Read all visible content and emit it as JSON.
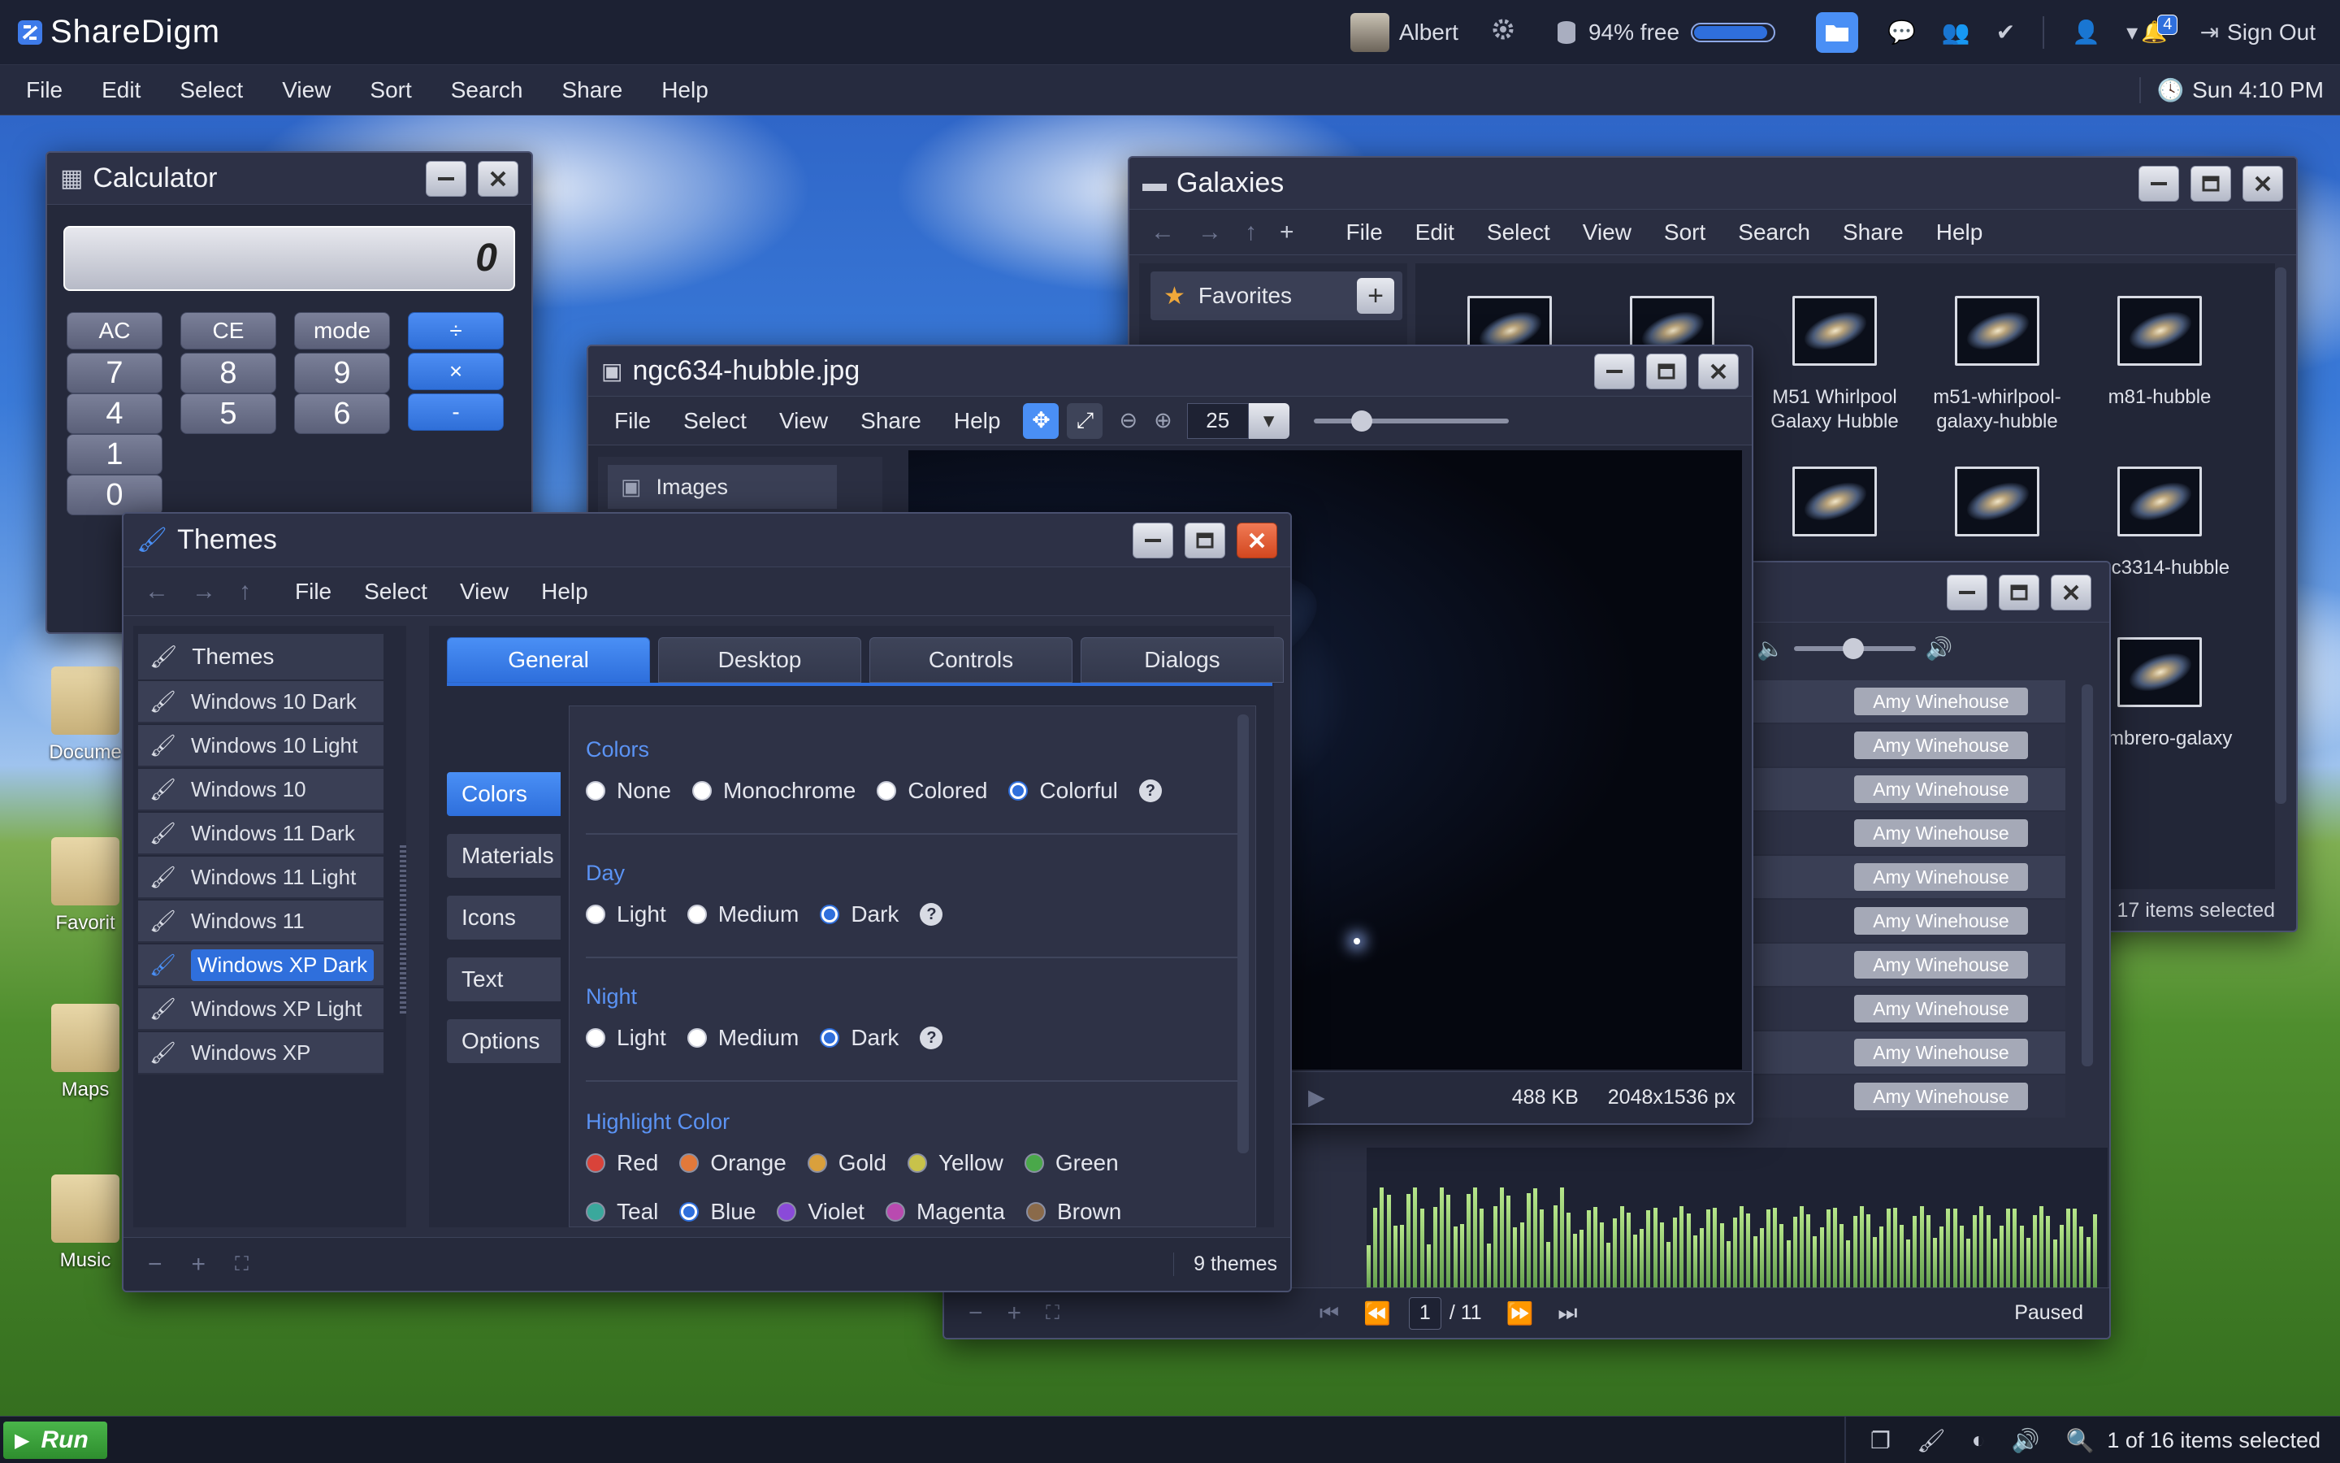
{
  "app": {
    "brand": "ShareDigm",
    "user": "Albert",
    "storage": "94% free",
    "storage_fraction": 0.94,
    "notifications_count": "4",
    "signout": "Sign Out",
    "clock": "Sun 4:10 PM"
  },
  "main_menu": [
    "File",
    "Edit",
    "Select",
    "View",
    "Sort",
    "Search",
    "Share",
    "Help"
  ],
  "desktop_icons": [
    "Docume",
    "Favorit",
    "Maps",
    "Music"
  ],
  "calculator": {
    "title": "Calculator",
    "display": "0",
    "rows": [
      [
        "AC",
        "CE",
        "mode",
        "÷"
      ],
      [
        "7",
        "8",
        "9",
        "×"
      ],
      [
        "4",
        "5",
        "6",
        "-"
      ],
      [
        "1",
        "",
        "",
        ""
      ],
      [
        "0",
        "",
        "",
        ""
      ]
    ]
  },
  "galaxies": {
    "title": "Galaxies",
    "menu": [
      "File",
      "Edit",
      "Select",
      "View",
      "Sort",
      "Search",
      "Share",
      "Help"
    ],
    "favorites_label": "Favorites",
    "items": [
      {
        "label": ""
      },
      {
        "label": ""
      },
      {
        "label": "M51 Whirlpool Galaxy Hubble"
      },
      {
        "label": "m51-whirlpool-galaxy-hubble"
      },
      {
        "label": "m81-hubble"
      },
      {
        "label": ""
      },
      {
        "label": ""
      },
      {
        "label": ""
      },
      {
        "label": "ngc3314-hubble"
      },
      {
        "label": "sombrero-galaxy"
      }
    ],
    "status": "17 items selected"
  },
  "viewer": {
    "title": "ngc634-hubble.jpg",
    "menu": [
      "File",
      "Select",
      "View",
      "Share",
      "Help"
    ],
    "zoom": "25",
    "sidebar_label": "Images",
    "file_size": "488 KB",
    "dimensions": "2048x1536 px"
  },
  "player": {
    "artists": [
      "Amy Winehouse",
      "Amy Winehouse",
      "Amy Winehouse",
      "Amy Winehouse",
      "Amy Winehouse",
      "Amy Winehouse",
      "Amy Winehouse",
      "Amy Winehouse",
      "Amy Winehouse",
      "Amy Winehouse"
    ],
    "page": "1",
    "page_total": "/ 11",
    "status": "Paused"
  },
  "themes": {
    "title": "Themes",
    "menu": [
      "File",
      "Select",
      "View",
      "Help"
    ],
    "list_header": "Themes",
    "list": [
      "Windows 10 Dark",
      "Windows 10 Light",
      "Windows 10",
      "Windows 11 Dark",
      "Windows 11 Light",
      "Windows 11",
      "Windows XP Dark",
      "Windows XP Light",
      "Windows XP"
    ],
    "selected_index": 6,
    "tabs": [
      "General",
      "Desktop",
      "Controls",
      "Dialogs"
    ],
    "subnav": [
      "Colors",
      "Materials",
      "Icons",
      "Text",
      "Options"
    ],
    "sections": {
      "colors": {
        "label": "Colors",
        "options": [
          "None",
          "Monochrome",
          "Colored",
          "Colorful"
        ],
        "selected": "Colorful"
      },
      "day": {
        "label": "Day",
        "options": [
          "Light",
          "Medium",
          "Dark"
        ],
        "selected": "Dark"
      },
      "night": {
        "label": "Night",
        "options": [
          "Light",
          "Medium",
          "Dark"
        ],
        "selected": "Dark"
      },
      "highlight": {
        "label": "Highlight Color",
        "options": [
          {
            "name": "Red",
            "color": "#d9433a"
          },
          {
            "name": "Orange",
            "color": "#e2793a"
          },
          {
            "name": "Gold",
            "color": "#d9a03c"
          },
          {
            "name": "Yellow",
            "color": "#c8c24a"
          },
          {
            "name": "Green",
            "color": "#4aa84a"
          },
          {
            "name": "Teal",
            "color": "#3aa89c"
          },
          {
            "name": "Blue",
            "color": "#2f6fdc"
          },
          {
            "name": "Violet",
            "color": "#8a4ad9"
          },
          {
            "name": "Magenta",
            "color": "#b94ab0"
          },
          {
            "name": "Brown",
            "color": "#8a6a4a"
          }
        ],
        "selected": "Blue"
      }
    },
    "status": "9 themes"
  },
  "taskbar": {
    "run": "Run",
    "status": "1 of 16 items selected"
  },
  "colors": {
    "accent": "#2f6fdc",
    "window_bg": "#2b2f42",
    "close_red": "#d2471f"
  }
}
